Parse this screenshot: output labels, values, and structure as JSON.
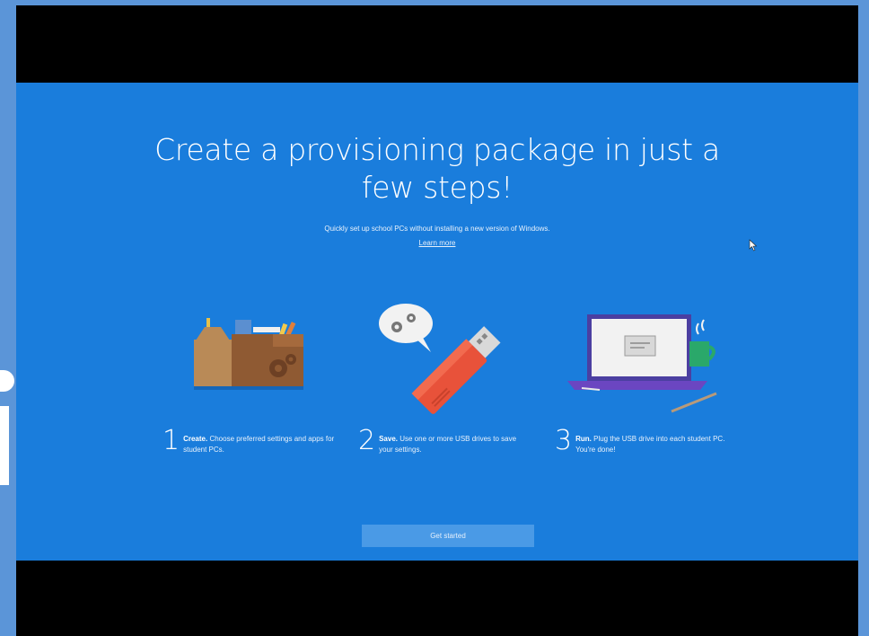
{
  "title_line1": "Create a provisioning package in just a",
  "title_line2": "few steps!",
  "subtitle": "Quickly set up school PCs without installing a new version of Windows.",
  "learn_more": "Learn more",
  "steps": [
    {
      "number": "1",
      "bold": "Create.",
      "text": "Choose preferred settings and apps for student PCs."
    },
    {
      "number": "2",
      "bold": "Save.",
      "text": "Use one or more USB drives to save your settings."
    },
    {
      "number": "3",
      "bold": "Run.",
      "text": "Plug the USB drive into each student PC. You're done!"
    }
  ],
  "get_started": "Get started",
  "colors": {
    "screen_bg": "#1a7ddc",
    "button_bg": "#4a9ae6",
    "outer_bg": "#5b95d8",
    "letterbox": "#000000"
  },
  "icons": [
    "toolbox-icon",
    "usb-drive-icon",
    "laptop-icon",
    "cursor-icon"
  ]
}
